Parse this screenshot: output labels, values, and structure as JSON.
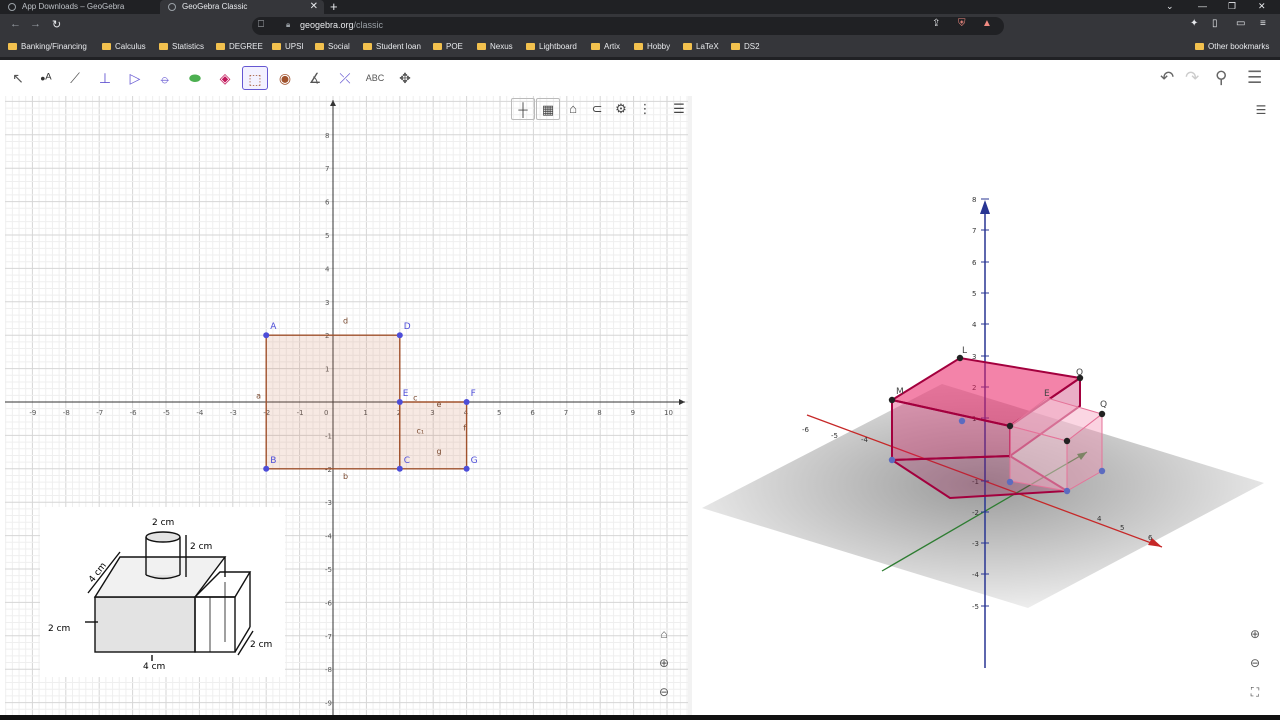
{
  "browser": {
    "tabs": [
      {
        "title": "App Downloads – GeoGebra"
      },
      {
        "title": "GeoGebra Classic"
      }
    ],
    "url_host": "geogebra.org",
    "url_path": "/classic",
    "bookmarks": [
      "Banking/Financing",
      "Calculus",
      "Statistics",
      "DEGREE",
      "UPSI",
      "Social",
      "Student loan",
      "POE",
      "Nexus",
      "Lightboard",
      "Artix",
      "Hobby",
      "LaTeX",
      "DS2"
    ],
    "other_bookmarks": "Other bookmarks"
  },
  "toolbar": {
    "text_tool": "ABC"
  },
  "graphics2d": {
    "x_ticks": [
      "-9",
      "-8",
      "-7",
      "-6",
      "-5",
      "-4",
      "-3",
      "-2",
      "-1",
      "0",
      "1",
      "2",
      "3",
      "4",
      "5",
      "6",
      "7",
      "8",
      "9",
      "10"
    ],
    "y_ticks": [
      "8",
      "7",
      "6",
      "5",
      "4",
      "3",
      "2",
      "1",
      "-1",
      "-2",
      "-3",
      "-4",
      "-5",
      "-6",
      "-7",
      "-8",
      "-9"
    ],
    "point_labels": {
      "A": "A",
      "B": "B",
      "C": "C",
      "D": "D",
      "E": "E",
      "F": "F",
      "G": "G"
    },
    "segment_labels": {
      "a": "a",
      "b": "b",
      "c": "c",
      "d": "d",
      "e": "e",
      "f": "f",
      "g": "g",
      "c1": "c₁"
    }
  },
  "sketch": {
    "top_diameter": "2 cm",
    "top_height": "2 cm",
    "depth": "4 cm",
    "height": "2 cm",
    "width": "4 cm",
    "side_depth": "2 cm"
  },
  "view3d": {
    "z_ticks": [
      "8",
      "7",
      "6",
      "5",
      "4",
      "3",
      "2",
      "1",
      "-1",
      "-2",
      "-3",
      "-4",
      "-5"
    ],
    "x_ticks": [
      "-6",
      "-5",
      "-4",
      "4",
      "5",
      "6"
    ],
    "point_labels": {
      "L": "L",
      "M": "M",
      "O": "O",
      "Q": "Q",
      "E": "E"
    }
  }
}
